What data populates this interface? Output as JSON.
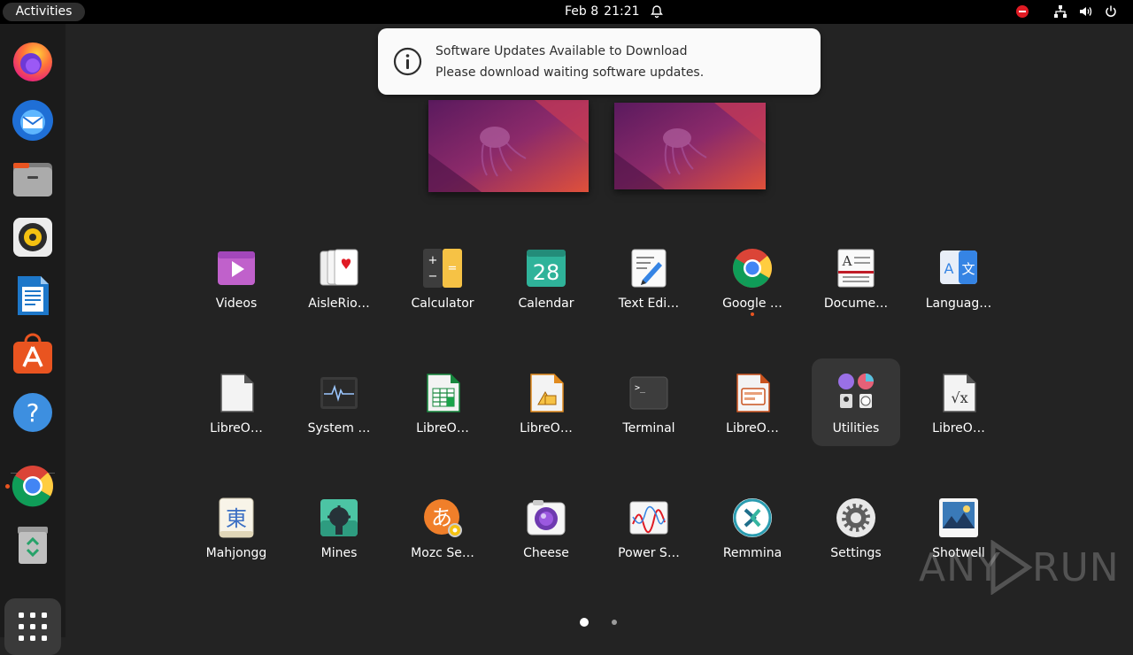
{
  "topbar": {
    "activities_label": "Activities",
    "date": "Feb 8",
    "time": "21:21",
    "icons": [
      "bell-icon",
      "do-not-disturb-icon",
      "network-icon",
      "volume-icon",
      "power-icon"
    ]
  },
  "notification": {
    "icon": "info-icon",
    "title": "Software Updates Available to Download",
    "body": "Please download waiting software updates."
  },
  "dock": {
    "apps": [
      "firefox",
      "thunderbird",
      "files",
      "rhythmbox",
      "libreoffice-writer",
      "ubuntu-software",
      "help",
      "google-chrome",
      "trash"
    ],
    "show_apps_icon": "show-apps-grid-icon",
    "running": [
      "google-chrome"
    ]
  },
  "app_grid": {
    "rows": [
      [
        {
          "label": "Videos",
          "icon": "videos-icon"
        },
        {
          "label": "AisleRio…",
          "icon": "aisleriot-icon"
        },
        {
          "label": "Calculator",
          "icon": "calculator-icon"
        },
        {
          "label": "Calendar",
          "icon": "calendar-icon",
          "icon_text": "28"
        },
        {
          "label": "Text Edi…",
          "icon": "text-editor-icon"
        },
        {
          "label": "Google …",
          "icon": "chrome-icon",
          "running": true
        },
        {
          "label": "Docume…",
          "icon": "document-viewer-icon"
        },
        {
          "label": "Languag…",
          "icon": "language-icon"
        }
      ],
      [
        {
          "label": "LibreO…",
          "icon": "libreoffice-icon"
        },
        {
          "label": "System …",
          "icon": "system-monitor-icon"
        },
        {
          "label": "LibreO…",
          "icon": "libreoffice-calc-icon"
        },
        {
          "label": "LibreO…",
          "icon": "libreoffice-draw-icon"
        },
        {
          "label": "Terminal",
          "icon": "terminal-icon"
        },
        {
          "label": "LibreO…",
          "icon": "libreoffice-impress-icon"
        },
        {
          "label": "Utilities",
          "icon": "utilities-folder-icon",
          "folder": true
        },
        {
          "label": "LibreO…",
          "icon": "libreoffice-math-icon"
        }
      ],
      [
        {
          "label": "Mahjongg",
          "icon": "mahjongg-icon",
          "icon_text": "東"
        },
        {
          "label": "Mines",
          "icon": "mines-icon"
        },
        {
          "label": "Mozc Se…",
          "icon": "mozc-icon",
          "icon_text": "あ"
        },
        {
          "label": "Cheese",
          "icon": "cheese-icon"
        },
        {
          "label": "Power S…",
          "icon": "power-statistics-icon"
        },
        {
          "label": "Remmina",
          "icon": "remmina-icon"
        },
        {
          "label": "Settings",
          "icon": "settings-icon"
        },
        {
          "label": "Shotwell",
          "icon": "shotwell-icon"
        }
      ]
    ],
    "pages": 2,
    "current_page": 1
  },
  "workspaces": [
    "workspace-1",
    "workspace-2"
  ],
  "watermark": {
    "left": "ANY",
    "right": "RUN"
  },
  "colors": {
    "accent": "#e95420",
    "panel": "#000000",
    "dock": "#1b1b1b",
    "background": "#232323"
  }
}
